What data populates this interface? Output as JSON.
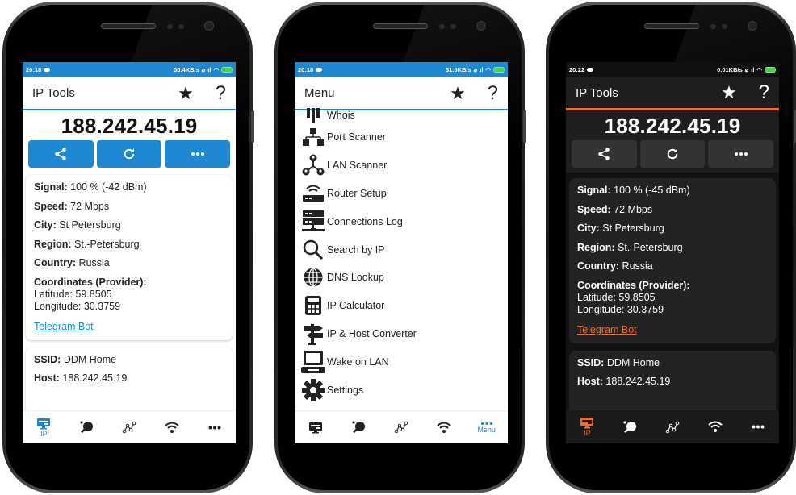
{
  "phones": [
    {
      "theme": "light",
      "status": {
        "time": "20:18",
        "speed": "30.4KB/s"
      },
      "appbar": {
        "title": "IP Tools",
        "star_icon": "★",
        "help_icon": "?"
      },
      "ip": "188.242.45.19",
      "actions": [
        {
          "icon": "share-icon"
        },
        {
          "icon": "refresh-icon"
        },
        {
          "icon": "more-icon"
        }
      ],
      "info": {
        "signal_label": "Signal:",
        "signal_value": " 100 % (-42 dBm)",
        "speed_label": "Speed:",
        "speed_value": " 72 Mbps",
        "city_label": "City:",
        "city_value": " St Petersburg",
        "region_label": "Region:",
        "region_value": " St.-Petersburg",
        "country_label": "Country:",
        "country_value": " Russia",
        "coords_label": "Coordinates (Provider):",
        "latitude": "Latitude: 59.8505",
        "longitude": "Longitude: 30.3759",
        "link": "Telegram Bot"
      },
      "network": {
        "ssid_label": "SSID:",
        "ssid_value": " DDM Home",
        "host_label": "Host:",
        "host_value": " 188.242.45.19"
      },
      "nav": {
        "ip_label": "IP",
        "menu_label": ""
      }
    },
    {
      "theme": "light",
      "status": {
        "time": "20:18",
        "speed": "31.9KB/s"
      },
      "appbar": {
        "title": "Menu",
        "star_icon": "★",
        "help_icon": "?"
      },
      "menu": [
        {
          "label": "Whois",
          "icon": "whois-icon"
        },
        {
          "label": "Port Scanner",
          "icon": "port-scanner-icon"
        },
        {
          "label": "LAN Scanner",
          "icon": "lan-scanner-icon"
        },
        {
          "label": "Router Setup",
          "icon": "router-icon"
        },
        {
          "label": "Connections Log",
          "icon": "connections-log-icon"
        },
        {
          "label": "Search by IP",
          "icon": "search-icon"
        },
        {
          "label": "DNS Lookup",
          "icon": "globe-icon"
        },
        {
          "label": "IP Calculator",
          "icon": "calculator-icon"
        },
        {
          "label": "IP & Host Converter",
          "icon": "signpost-icon"
        },
        {
          "label": "Wake on LAN",
          "icon": "computer-icon"
        },
        {
          "label": "Settings",
          "icon": "gear-icon"
        }
      ],
      "nav": {
        "ip_label": "",
        "menu_label": "Menu"
      }
    },
    {
      "theme": "dark",
      "status": {
        "time": "20:22",
        "speed": "0.01KB/s"
      },
      "appbar": {
        "title": "IP Tools",
        "star_icon": "★",
        "help_icon": "?"
      },
      "ip": "188.242.45.19",
      "info": {
        "signal_label": "Signal:",
        "signal_value": " 100 % (-45 dBm)",
        "speed_label": "Speed:",
        "speed_value": " 72 Mbps",
        "city_label": "City:",
        "city_value": " St Petersburg",
        "region_label": "Region:",
        "region_value": " St.-Petersburg",
        "country_label": "Country:",
        "country_value": " Russia",
        "coords_label": "Coordinates (Provider):",
        "latitude": "Latitude: 59.8505",
        "longitude": "Longitude: 30.3759",
        "link": "Telegram Bot"
      },
      "network": {
        "ssid_label": "SSID:",
        "ssid_value": " DDM Home",
        "host_label": "Host:",
        "host_value": " 188.242.45.19"
      },
      "nav": {
        "ip_label": "IP",
        "menu_label": ""
      }
    }
  ],
  "colors": {
    "light_accent": "#1e88d2",
    "dark_accent": "#e8702a"
  }
}
